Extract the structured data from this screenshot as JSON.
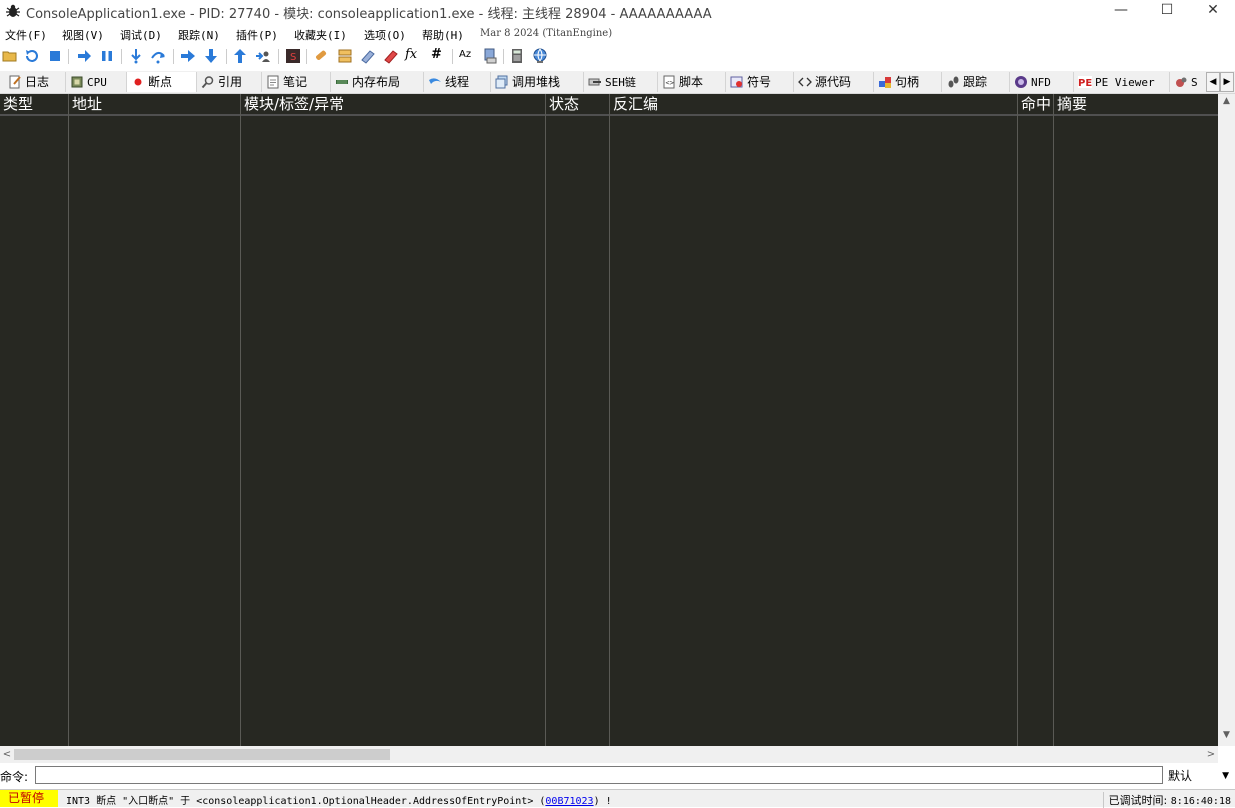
{
  "window": {
    "title": "ConsoleApplication1.exe - PID: 27740 - 模块: consoleapplication1.exe - 线程: 主线程 28904 - AAAAAAAAAA",
    "minimize": "—",
    "maximize": "☐",
    "close": "✕"
  },
  "menu": {
    "items": [
      "文件(F)",
      "视图(V)",
      "调试(D)",
      "跟踪(N)",
      "插件(P)",
      "收藏夹(I)",
      "选项(O)",
      "帮助(H)"
    ],
    "build": "Mar 8 2024 (TitanEngine)"
  },
  "toolbar": {
    "fx": "fx",
    "hash": "#",
    "az": "Aᴢ"
  },
  "tabs": [
    {
      "label": "日志",
      "icon": "log-icon"
    },
    {
      "label": "CPU",
      "icon": "cpu-icon"
    },
    {
      "label": "断点",
      "icon": "breakpoint-dot-icon",
      "active": true
    },
    {
      "label": "引用",
      "icon": "search-icon"
    },
    {
      "label": "笔记",
      "icon": "notes-icon"
    },
    {
      "label": "内存布局",
      "icon": "memory-icon"
    },
    {
      "label": "线程",
      "icon": "thread-icon"
    },
    {
      "label": "调用堆栈",
      "icon": "callstack-icon"
    },
    {
      "label": "SEH链",
      "icon": "seh-icon"
    },
    {
      "label": "脚本",
      "icon": "script-icon"
    },
    {
      "label": "符号",
      "icon": "symbol-icon"
    },
    {
      "label": "源代码",
      "icon": "source-icon"
    },
    {
      "label": "句柄",
      "icon": "handle-icon"
    },
    {
      "label": "跟踪",
      "icon": "trace-icon"
    },
    {
      "label": "NFD",
      "icon": "nfd-icon"
    },
    {
      "label": "PE Viewer",
      "icon": "pe-icon"
    },
    {
      "label": "S",
      "icon": "plugin-icon"
    }
  ],
  "table": {
    "columns": [
      "类型",
      "地址",
      "模块/标签/异常",
      "状态",
      "反汇编",
      "命中",
      "摘要"
    ]
  },
  "command": {
    "label": "命令:",
    "value": "",
    "mode": "默认"
  },
  "status": {
    "state": "已暂停",
    "message_prefix": "INT3  断点 \"入口断点\" 于 <consoleapplication1.OptionalHeader.AddressOfEntryPoint> (",
    "address": "00B71023",
    "message_suffix": ") !",
    "timer_label": "已调试时间:",
    "timer_value": "8:16:40:18"
  },
  "colors": {
    "grid_background": "#272822",
    "grid_text": "#ffffff",
    "status_paused_bg": "#ffff00",
    "status_paused_fg": "#c00000"
  }
}
